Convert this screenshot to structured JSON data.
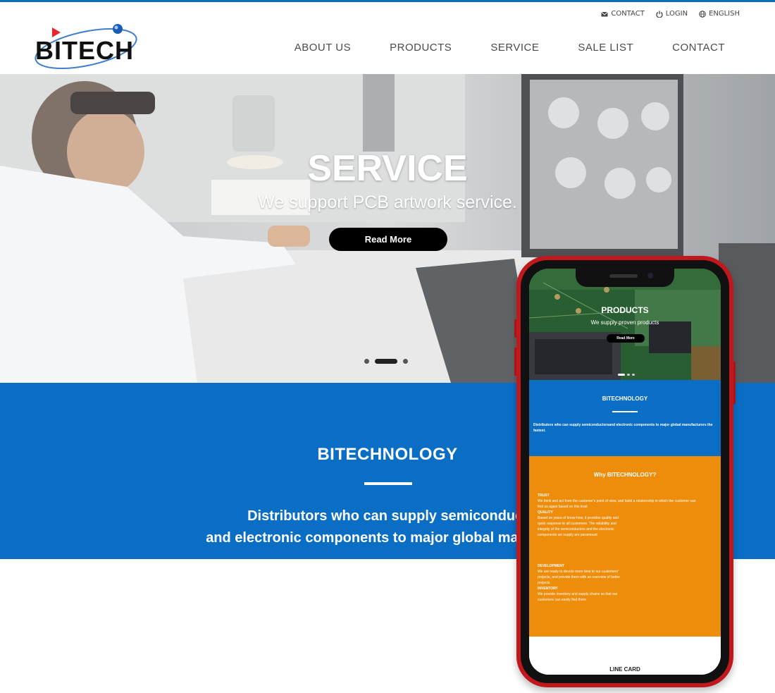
{
  "colors": {
    "accent_blue": "#0b6ec5",
    "accent_orange": "#ee8d0b",
    "phone_red": "#c1181d"
  },
  "logo": {
    "text": "BITECH"
  },
  "util_menu": [
    {
      "label": "CONTACT",
      "icon": "envelope-icon"
    },
    {
      "label": "LOGIN",
      "icon": "power-icon"
    },
    {
      "label": "ENGLISH",
      "icon": "globe-icon"
    }
  ],
  "nav": [
    "ABOUT US",
    "PRODUCTS",
    "SERVICE",
    "SALE LIST",
    "CONTACT"
  ],
  "hero": {
    "title": "SERVICE",
    "subtitle": "We support PCB artwork service.",
    "button": "Read More",
    "slides": 3,
    "active_slide": 2
  },
  "intro": {
    "title": "BITECHNOLOGY",
    "line1": "Distributors who can supply semiconduct",
    "line2": "and electronic components to major global manufactu"
  },
  "mobile": {
    "hero_title": "PRODUCTS",
    "hero_subtitle": "We supply proven products",
    "hero_button": "Read More",
    "blue_title": "BITECHNOLOGY",
    "blue_text": "Distributors who can supply semiconductorsand electronic components to major global manufacturers the fastest.",
    "orange_title": "Why BITECHNOLOGY?",
    "blocks": [
      {
        "heading": "TRUST",
        "text": "We think and act from the customer's point of view, and build a relationship in which the customer can find us again based on this trust"
      },
      {
        "heading": "QUALITY",
        "text": "Based on years of know-how, it provides quality and quick response to all customers. The reliability and integrity of the semiconductors and the electronic components we supply are paramount"
      },
      {
        "heading": "DEVELOPMENT",
        "text": "We are ready to devote more time to our customers' projects, and provide them with an overview of better projects"
      },
      {
        "heading": "INVENTORY",
        "text": "We provide inventory and supply chains so that our customers can easily find them"
      }
    ],
    "line_card": "LINE CARD"
  }
}
